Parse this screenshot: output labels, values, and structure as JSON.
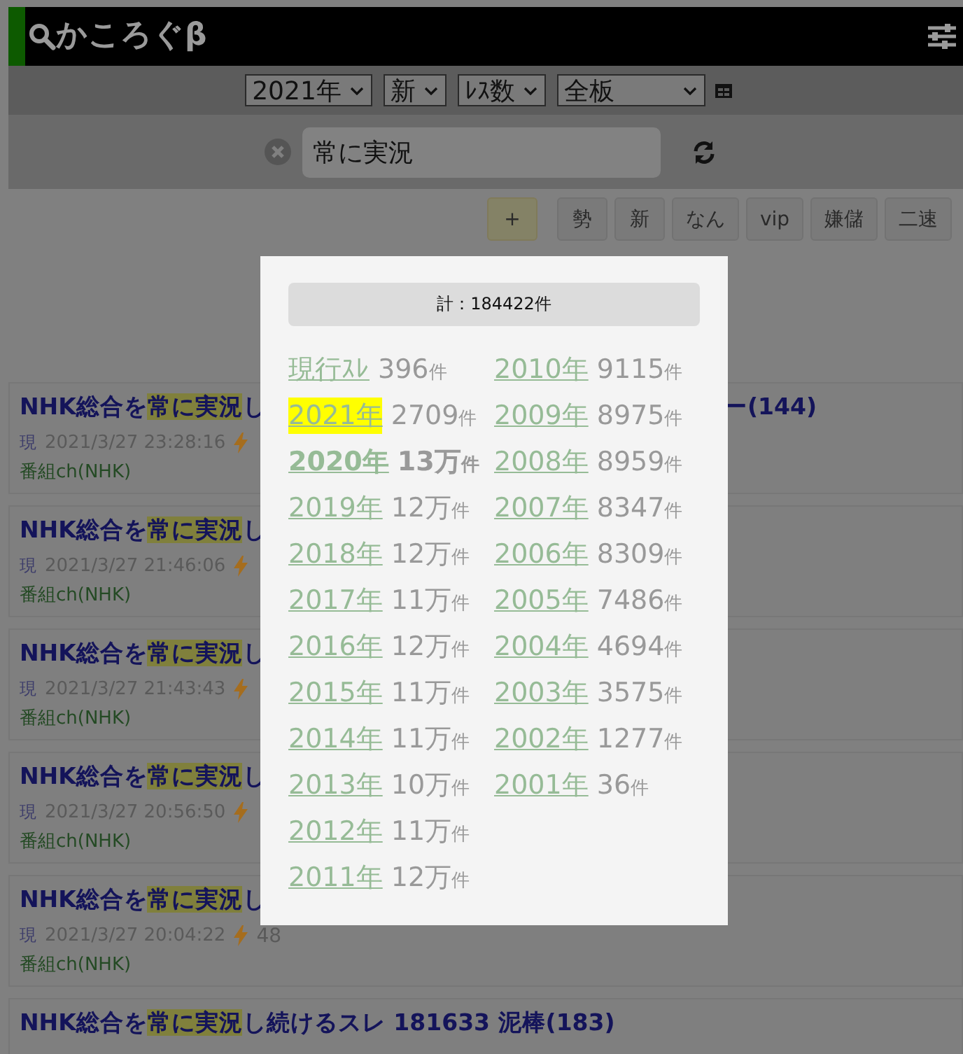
{
  "header": {
    "title": "かころぐβ"
  },
  "filters": [
    {
      "value": "2021年"
    },
    {
      "value": "新"
    },
    {
      "value": "ﾚｽ数"
    },
    {
      "value": "全板",
      "wide": true
    }
  ],
  "search": {
    "value": "常に実況"
  },
  "boards": [
    {
      "label": "+",
      "kind": "add"
    },
    {
      "label": "勢",
      "kind": "board"
    },
    {
      "label": "新",
      "kind": "board"
    },
    {
      "label": "なん",
      "kind": "board"
    },
    {
      "label": "vip",
      "kind": "board"
    },
    {
      "label": "嫌儲",
      "kind": "board"
    },
    {
      "label": "二速",
      "kind": "board"
    }
  ],
  "threads": [
    {
      "title": [
        {
          "text": "NHK総合を",
          "kind": "plain"
        },
        {
          "text": "常に実況",
          "kind": "match"
        },
        {
          "text": "し",
          "kind": "plain"
        }
      ],
      "title_tail": "ー(144)",
      "status": "現",
      "date": "2021/3/27 23:28:16",
      "board": "番組ch(NHK)"
    },
    {
      "title": [
        {
          "text": "NHK総合を",
          "kind": "plain"
        },
        {
          "text": "常に実況",
          "kind": "match"
        },
        {
          "text": "し",
          "kind": "plain"
        }
      ],
      "status": "現",
      "date": "2021/3/27 21:46:06",
      "board": "番組ch(NHK)"
    },
    {
      "title": [
        {
          "text": "NHK総合を",
          "kind": "plain"
        },
        {
          "text": "常に実況",
          "kind": "match"
        },
        {
          "text": "し",
          "kind": "plain"
        }
      ],
      "status": "現",
      "date": "2021/3/27 21:43:43",
      "board": "番組ch(NHK)"
    },
    {
      "title": [
        {
          "text": "NHK総合を",
          "kind": "plain"
        },
        {
          "text": "常に実況",
          "kind": "match"
        },
        {
          "text": "し",
          "kind": "plain"
        }
      ],
      "status": "現",
      "date": "2021/3/27 20:56:50",
      "board": "番組ch(NHK)"
    },
    {
      "title": [
        {
          "text": "NHK総合を",
          "kind": "plain"
        },
        {
          "text": "常に実況",
          "kind": "match"
        },
        {
          "text": "し",
          "kind": "plain"
        }
      ],
      "status": "現",
      "date": "2021/3/27 20:04:22",
      "speed": "48",
      "board": "番組ch(NHK)"
    },
    {
      "title": [
        {
          "text": "NHK総合を",
          "kind": "plain"
        },
        {
          "text": "常に実況",
          "kind": "match"
        },
        {
          "text": "し続けるスレ 181633 泥棒(183)",
          "kind": "plain"
        }
      ]
    }
  ],
  "popup": {
    "total": "計：184422件",
    "columns": [
      [
        {
          "label": "現行ｽﾚ",
          "count": "396",
          "unit": "件",
          "highlighted": false,
          "bold": false
        },
        {
          "label": "2021年",
          "count": "2709",
          "unit": "件",
          "highlighted": true,
          "bold": false
        },
        {
          "label": "2020年",
          "count": "13万",
          "unit": "件",
          "highlighted": false,
          "bold": true
        },
        {
          "label": "2019年",
          "count": "12万",
          "unit": "件",
          "highlighted": false,
          "bold": false
        },
        {
          "label": "2018年",
          "count": "12万",
          "unit": "件",
          "highlighted": false,
          "bold": false
        },
        {
          "label": "2017年",
          "count": "11万",
          "unit": "件",
          "highlighted": false,
          "bold": false
        },
        {
          "label": "2016年",
          "count": "12万",
          "unit": "件",
          "highlighted": false,
          "bold": false
        },
        {
          "label": "2015年",
          "count": "11万",
          "unit": "件",
          "highlighted": false,
          "bold": false
        },
        {
          "label": "2014年",
          "count": "11万",
          "unit": "件",
          "highlighted": false,
          "bold": false
        },
        {
          "label": "2013年",
          "count": "10万",
          "unit": "件",
          "highlighted": false,
          "bold": false
        },
        {
          "label": "2012年",
          "count": "11万",
          "unit": "件",
          "highlighted": false,
          "bold": false
        },
        {
          "label": "2011年",
          "count": "12万",
          "unit": "件",
          "highlighted": false,
          "bold": false
        }
      ],
      [
        {
          "label": "2010年",
          "count": "9115",
          "unit": "件",
          "highlighted": false,
          "bold": false
        },
        {
          "label": "2009年",
          "count": "8975",
          "unit": "件",
          "highlighted": false,
          "bold": false
        },
        {
          "label": "2008年",
          "count": "8959",
          "unit": "件",
          "highlighted": false,
          "bold": false
        },
        {
          "label": "2007年",
          "count": "8347",
          "unit": "件",
          "highlighted": false,
          "bold": false
        },
        {
          "label": "2006年",
          "count": "8309",
          "unit": "件",
          "highlighted": false,
          "bold": false
        },
        {
          "label": "2005年",
          "count": "7486",
          "unit": "件",
          "highlighted": false,
          "bold": false
        },
        {
          "label": "2004年",
          "count": "4694",
          "unit": "件",
          "highlighted": false,
          "bold": false
        },
        {
          "label": "2003年",
          "count": "3575",
          "unit": "件",
          "highlighted": false,
          "bold": false
        },
        {
          "label": "2002年",
          "count": "1277",
          "unit": "件",
          "highlighted": false,
          "bold": false
        },
        {
          "label": "2001年",
          "count": "36",
          "unit": "件",
          "highlighted": false,
          "bold": false
        }
      ]
    ]
  }
}
